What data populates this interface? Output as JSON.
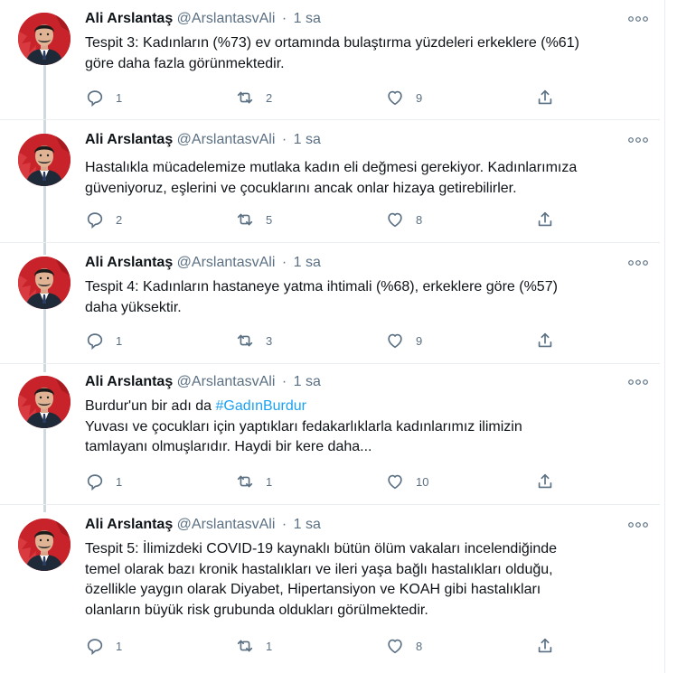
{
  "author": {
    "name": "Ali Arslantaş",
    "handle": "@ArslantasvAli",
    "separator": "·",
    "time": "1 sa"
  },
  "icons": {
    "reply": "reply-icon",
    "retweet": "retweet-icon",
    "like": "heart-icon",
    "share": "share-icon",
    "more": "more-options-icon"
  },
  "colors": {
    "accent": "#1da1f2",
    "secondary_text": "#5b7083",
    "thread_line": "#cfd9de"
  },
  "tweets": [
    {
      "lines": [
        "Tespit 3: Kadınların (%73) ev ortamında bulaştırma yüzdeleri erkeklere (%61)",
        "göre daha fazla görünmektedir."
      ],
      "replies": "1",
      "retweets": "2",
      "likes": "9"
    },
    {
      "lines": [
        "Hastalıkla mücadelemize mutlaka kadın eli değmesi gerekiyor. Kadınlarımıza",
        "güveniyoruz, eşlerini ve çocuklarını ancak onlar hizaya getirebilirler."
      ],
      "replies": "2",
      "retweets": "5",
      "likes": "8"
    },
    {
      "lines": [
        "Tespit 4: Kadınların hastaneye yatma ihtimali (%68), erkeklere göre (%57)",
        "daha yüksektir."
      ],
      "replies": "1",
      "retweets": "3",
      "likes": "9"
    },
    {
      "intro": "Burdur'un bir adı da",
      "hashtag": "#GadınBurdur",
      "lines": [
        "Yuvası ve çocukları için yaptıkları fedakarlıklarla kadınlarımız ilimizin",
        "tamlayanı olmuşlarıdır. Haydi bir kere daha..."
      ],
      "replies": "1",
      "retweets": "1",
      "likes": "10"
    },
    {
      "lines": [
        "Tespit 5: İlimizdeki COVID-19 kaynaklı bütün ölüm vakaları incelendiğinde",
        "temel olarak bazı kronik hastalıkları ve ileri yaşa bağlı hastalıkları olduğu,",
        "özellikle yaygın olarak Diyabet, Hipertansiyon ve KOAH gibi hastalıkları",
        "olanların büyük risk grubunda oldukları görülmektedir."
      ],
      "replies": "1",
      "retweets": "1",
      "likes": "8"
    }
  ]
}
